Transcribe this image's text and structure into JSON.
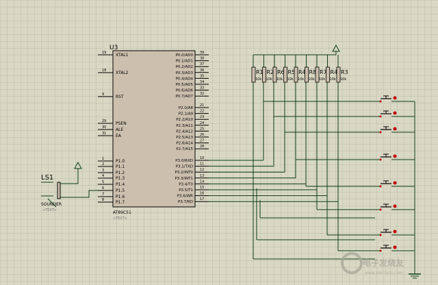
{
  "colors": {
    "background": "#d8d8c4",
    "grid": "#bcbca8",
    "chip_fill": "#ccbfae",
    "wire": "#0b3d16",
    "outline": "#000000",
    "pin_label": "#000000",
    "pin_number": "#000000",
    "button_dot": "#c00000",
    "ground_symbol": "#123c12",
    "watermark": "#a7a79a"
  },
  "chip": {
    "refdes": "U3",
    "part": "AT89C51",
    "text_placeholder": "<TEXT>",
    "left_pins": [
      {
        "num": "19",
        "name": "XTAL1"
      },
      {
        "num": "18",
        "name": "XTAL2"
      },
      {
        "num": "9",
        "name": "RST"
      },
      {
        "num": "29",
        "name": "PSEN"
      },
      {
        "num": "30",
        "name": "ALE"
      },
      {
        "num": "31",
        "name": "EA"
      },
      {
        "num": "1",
        "name": "P1.0"
      },
      {
        "num": "2",
        "name": "P1.1"
      },
      {
        "num": "3",
        "name": "P1.2"
      },
      {
        "num": "4",
        "name": "P1.3"
      },
      {
        "num": "5",
        "name": "P1.4"
      },
      {
        "num": "6",
        "name": "P1.5"
      },
      {
        "num": "7",
        "name": "P1.6"
      },
      {
        "num": "8",
        "name": "P1.7"
      }
    ],
    "right_pins_port0": [
      {
        "num": "39",
        "name": "P0.0/AD0"
      },
      {
        "num": "38",
        "name": "P0.1/AD1"
      },
      {
        "num": "37",
        "name": "P0.2/AD2"
      },
      {
        "num": "36",
        "name": "P0.3/AD3"
      },
      {
        "num": "35",
        "name": "P0.4/AD4"
      },
      {
        "num": "34",
        "name": "P0.5/AD5"
      },
      {
        "num": "33",
        "name": "P0.6/AD6"
      },
      {
        "num": "32",
        "name": "P0.7/AD7"
      }
    ],
    "right_pins_port2": [
      {
        "num": "21",
        "name": "P2.0/A8"
      },
      {
        "num": "22",
        "name": "P2.1/A9"
      },
      {
        "num": "23",
        "name": "P2.2/A10"
      },
      {
        "num": "24",
        "name": "P2.3/A11"
      },
      {
        "num": "25",
        "name": "P2.4/A12"
      },
      {
        "num": "26",
        "name": "P2.5/A13"
      },
      {
        "num": "27",
        "name": "P2.6/A14"
      },
      {
        "num": "28",
        "name": "P2.7/A15"
      }
    ],
    "right_pins_port3": [
      {
        "num": "10",
        "name": "P3.0/RXD"
      },
      {
        "num": "11",
        "name": "P3.1/TXD"
      },
      {
        "num": "12",
        "name": "P3.2/INT0"
      },
      {
        "num": "13",
        "name": "P3.3/INT1"
      },
      {
        "num": "14",
        "name": "P3.4/T0"
      },
      {
        "num": "15",
        "name": "P3.5/T1"
      },
      {
        "num": "16",
        "name": "P3.6/WR"
      },
      {
        "num": "17",
        "name": "P3.7/RD"
      }
    ]
  },
  "resistors": {
    "labels": [
      "R1",
      "R2",
      "R6",
      "R5",
      "R4",
      "R8",
      "R7",
      "R4",
      "R3"
    ],
    "value": "10k",
    "count": 9
  },
  "sounder": {
    "refdes": "LS1",
    "part": "SOUNDER",
    "text_placeholder": "<TEXT>"
  },
  "buttons": {
    "count": 8
  },
  "watermark": {
    "text": "电子发烧友",
    "url": "www.elecfans.com"
  }
}
